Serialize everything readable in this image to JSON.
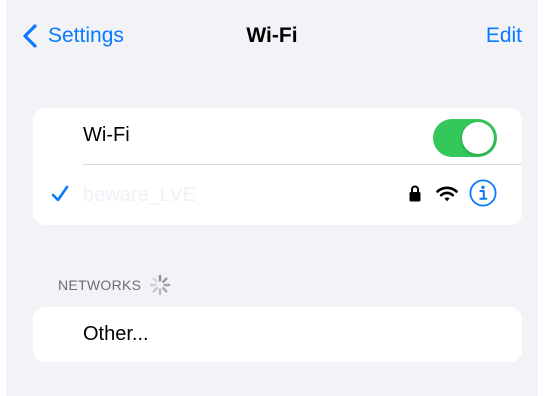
{
  "nav": {
    "back_label": "Settings",
    "title": "Wi-Fi",
    "edit_label": "Edit"
  },
  "wifi": {
    "label": "Wi-Fi",
    "enabled": true,
    "toggle_color": "#34c759"
  },
  "connected_network": {
    "name": "beware_LVE",
    "secured": true,
    "icons": [
      "checkmark-icon",
      "lock-icon",
      "wifi-signal-icon",
      "info-icon"
    ]
  },
  "networks_section": {
    "title": "NETWORKS",
    "loading": true
  },
  "other": {
    "label": "Other..."
  },
  "colors": {
    "accent": "#0a7aff",
    "background": "#f2f2f7",
    "card": "#ffffff"
  }
}
